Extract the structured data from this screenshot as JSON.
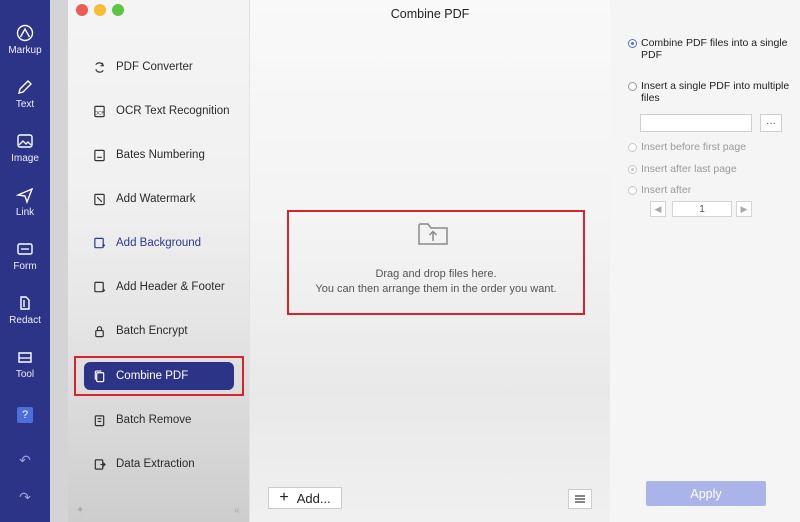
{
  "rail": {
    "items": [
      {
        "label": "Markup",
        "icon": "markup-icon"
      },
      {
        "label": "Text",
        "icon": "text-pen-icon"
      },
      {
        "label": "Image",
        "icon": "image-icon"
      },
      {
        "label": "Link",
        "icon": "link-send-icon"
      },
      {
        "label": "Form",
        "icon": "form-icon"
      },
      {
        "label": "Redact",
        "icon": "redact-icon"
      },
      {
        "label": "Tool",
        "icon": "tool-icon"
      }
    ],
    "help": "?",
    "undo": "↶",
    "redo": "↷"
  },
  "sidebar": {
    "items": [
      {
        "label": "PDF Converter",
        "icon": "convert-icon"
      },
      {
        "label": "OCR Text Recognition",
        "icon": "ocr-icon"
      },
      {
        "label": "Bates Numbering",
        "icon": "bates-icon"
      },
      {
        "label": "Add Watermark",
        "icon": "watermark-icon"
      },
      {
        "label": "Add Background",
        "icon": "background-icon"
      },
      {
        "label": "Add Header & Footer",
        "icon": "header-footer-icon"
      },
      {
        "label": "Batch Encrypt",
        "icon": "lock-icon"
      },
      {
        "label": "Combine PDF",
        "icon": "combine-icon"
      },
      {
        "label": "Batch Remove",
        "icon": "trash-icon"
      },
      {
        "label": "Data Extraction",
        "icon": "extract-icon"
      }
    ],
    "active": "Combine PDF",
    "foot_left": "✦",
    "foot_right": "«"
  },
  "main": {
    "title": "Combine PDF",
    "drop_line1": "Drag and drop files here.",
    "drop_line2": "You can then arrange them in the order you want.",
    "add_label": "Add...",
    "add_plus": "+"
  },
  "options": {
    "combine_single": "Combine PDF files into a single PDF",
    "insert_multiple": "Insert a single PDF into multiple files",
    "path_value": "",
    "browse": "···",
    "before_first": "Insert before first page",
    "after_last": "Insert after last page",
    "insert_after": "Insert after",
    "page_value": "1",
    "prev": "◀",
    "next": "▶",
    "apply": "Apply"
  },
  "colors": {
    "rail": "#2c3488",
    "highlight": "#d8232a",
    "apply": "#aab4e8"
  }
}
